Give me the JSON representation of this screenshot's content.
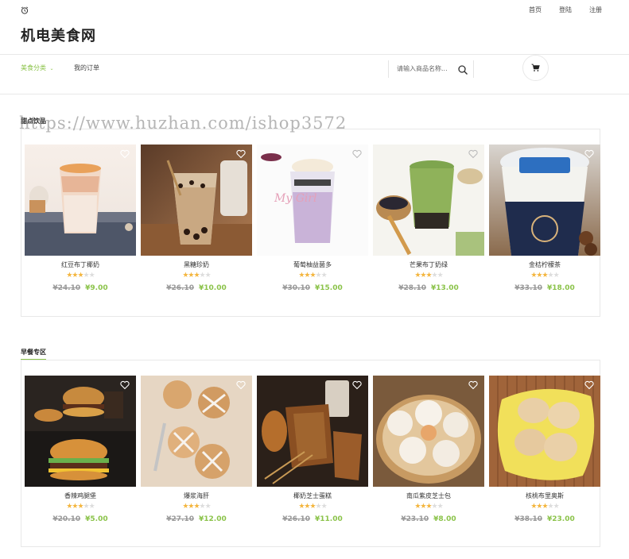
{
  "header": {
    "links": [
      "首页",
      "登陆",
      "注册"
    ],
    "site_title": "机电美食网"
  },
  "nav": {
    "category_label": "美食分类",
    "orders_label": "我的订单",
    "search_placeholder": "请输入商品名称..."
  },
  "watermark": "https://www.huzhan.com/ishop3572",
  "sections": [
    {
      "title": "甜点饮品",
      "products": [
        {
          "name": "红豆布丁椰奶",
          "rating": 3,
          "old_price": "¥24.10",
          "price": "¥9.00"
        },
        {
          "name": "黑糖珍奶",
          "rating": 3,
          "old_price": "¥26.10",
          "price": "¥10.00"
        },
        {
          "name": "葡萄柚益菌多",
          "rating": 3,
          "old_price": "¥30.10",
          "price": "¥15.00"
        },
        {
          "name": "芒果布丁奶绿",
          "rating": 3,
          "old_price": "¥28.10",
          "price": "¥13.00"
        },
        {
          "name": "金桔柠檬茶",
          "rating": 3,
          "old_price": "¥33.10",
          "price": "¥18.00"
        }
      ]
    },
    {
      "title": "早餐专区",
      "products": [
        {
          "name": "香辣鸡腿堡",
          "rating": 3,
          "old_price": "¥20.10",
          "price": "¥5.00"
        },
        {
          "name": "爆浆海肝",
          "rating": 3,
          "old_price": "¥27.10",
          "price": "¥12.00"
        },
        {
          "name": "椰奶芝士蛋糕",
          "rating": 3,
          "old_price": "¥26.10",
          "price": "¥11.00"
        },
        {
          "name": "南瓜紫皮芝士包",
          "rating": 3,
          "old_price": "¥23.10",
          "price": "¥8.00"
        },
        {
          "name": "核桃布里奥斯",
          "rating": 3,
          "old_price": "¥38.10",
          "price": "¥23.00"
        }
      ]
    }
  ],
  "colors": {
    "accent": "#8bc34a",
    "star": "#f4b63f"
  }
}
